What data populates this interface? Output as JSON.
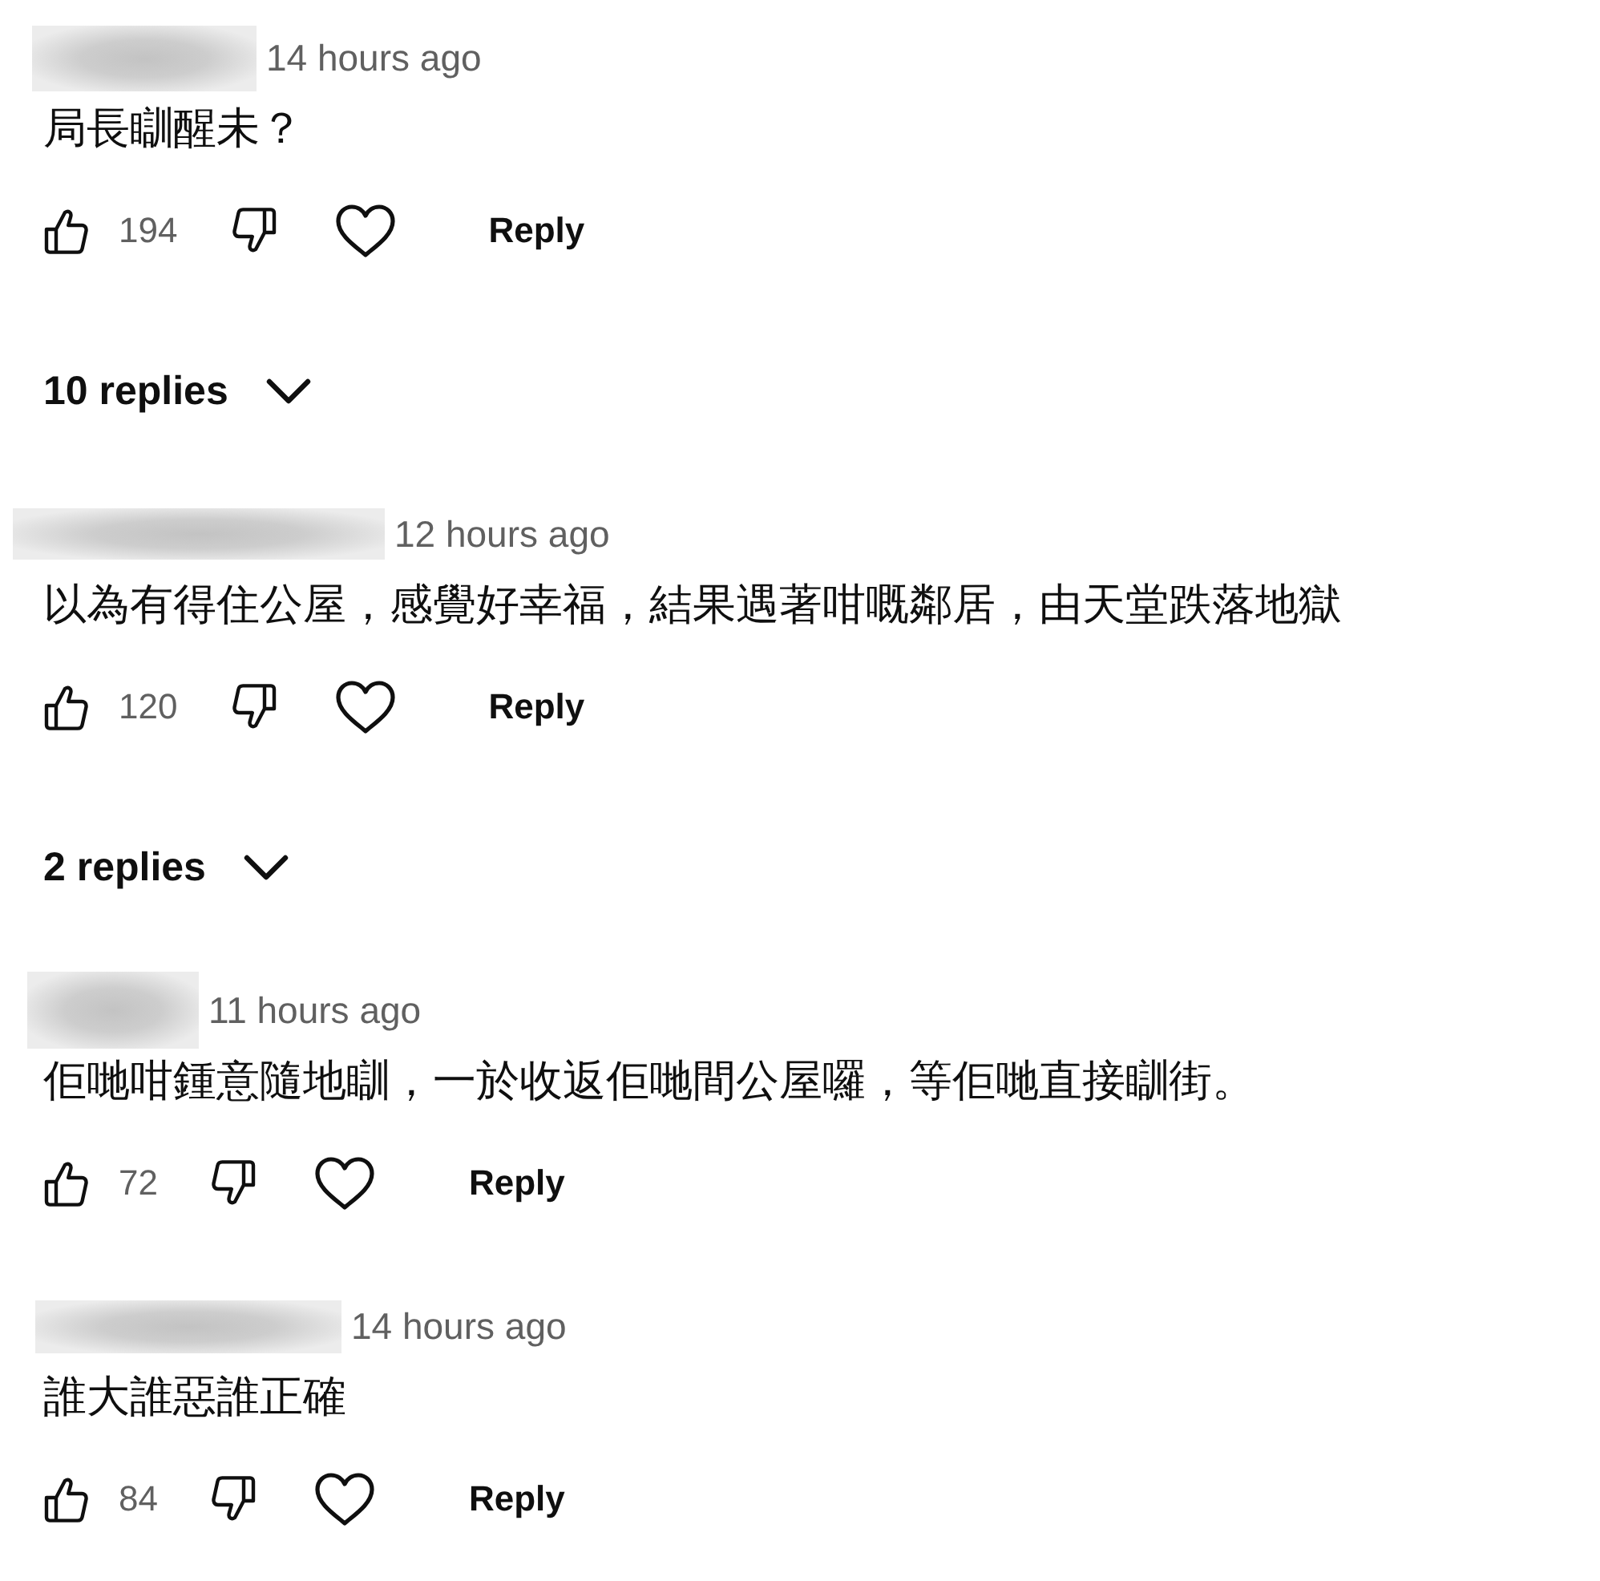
{
  "comments": [
    {
      "time": "14 hours ago",
      "text": "局長瞓醒未？",
      "likes": "194",
      "reply_label": "Reply",
      "replies": "10 replies"
    },
    {
      "time": "12 hours ago",
      "text": "以為有得住公屋，感覺好幸福，結果遇著咁嘅鄰居，由天堂跌落地獄",
      "likes": "120",
      "reply_label": "Reply",
      "replies": "2 replies"
    },
    {
      "time": "11 hours ago",
      "text": "佢哋咁鍾意隨地瞓，一於收返佢哋間公屋囉，等佢哋直接瞓街。",
      "likes": "72",
      "reply_label": "Reply"
    },
    {
      "time": "14 hours ago",
      "text": "誰大誰惡誰正確",
      "likes": "84",
      "reply_label": "Reply"
    }
  ]
}
